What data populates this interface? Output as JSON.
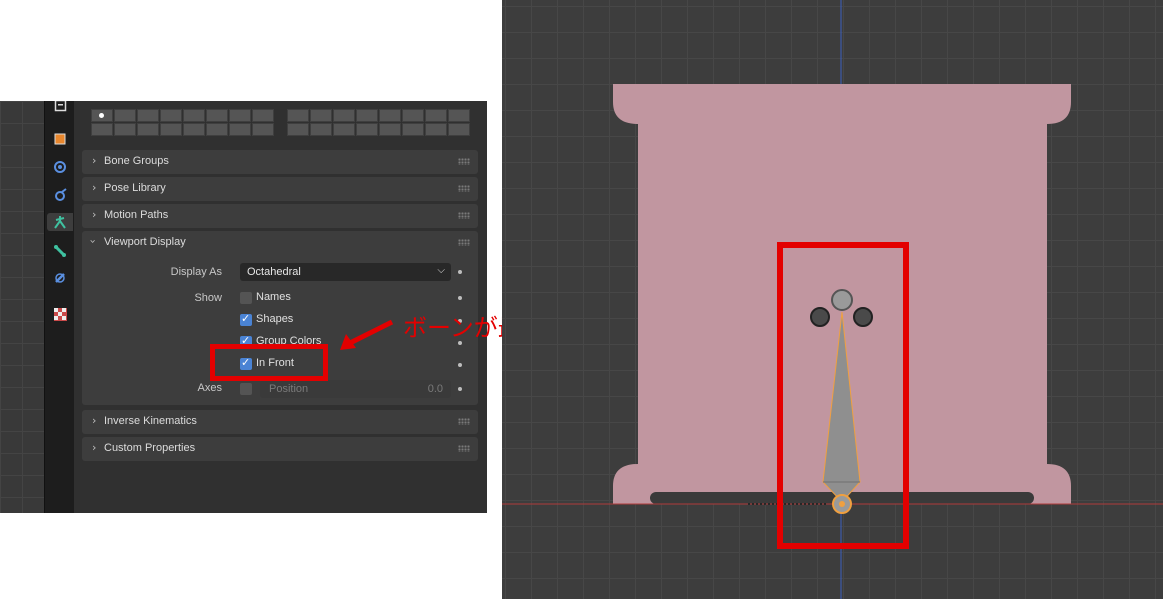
{
  "properties": {
    "panels": [
      {
        "label": "Bone Groups",
        "expanded": false
      },
      {
        "label": "Pose Library",
        "expanded": false
      },
      {
        "label": "Motion Paths",
        "expanded": false
      },
      {
        "label": "Viewport Display",
        "expanded": true
      },
      {
        "label": "Inverse Kinematics",
        "expanded": false
      },
      {
        "label": "Custom Properties",
        "expanded": false
      }
    ],
    "viewport_display": {
      "display_as_label": "Display As",
      "display_as_value": "Octahedral",
      "show_label": "Show",
      "names_label": "Names",
      "names_checked": false,
      "shapes_label": "Shapes",
      "shapes_checked": true,
      "group_colors_label": "Group Colors",
      "group_colors_checked": true,
      "in_front_label": "In Front",
      "in_front_checked": true,
      "axes_label": "Axes",
      "axes_checked": false,
      "position_label": "Position",
      "position_value": "0.0"
    },
    "tabs": [
      "tool-tab",
      "object-tab",
      "modifier-tab",
      "physics-tab",
      "armature-tab",
      "bone-tab",
      "bone-constraint-tab",
      "texture-tab"
    ],
    "active_tab": "armature-tab"
  },
  "annotation": {
    "text": "ボーンが最前面に表示される",
    "color": "#e30000"
  },
  "viewport": {
    "mesh_color": "#c196a0",
    "bone_color": "#8a8a8a",
    "selection_color": "#f0a040",
    "x_axis_color": "#b03a3a",
    "z_axis_color": "#3a5fc0"
  }
}
